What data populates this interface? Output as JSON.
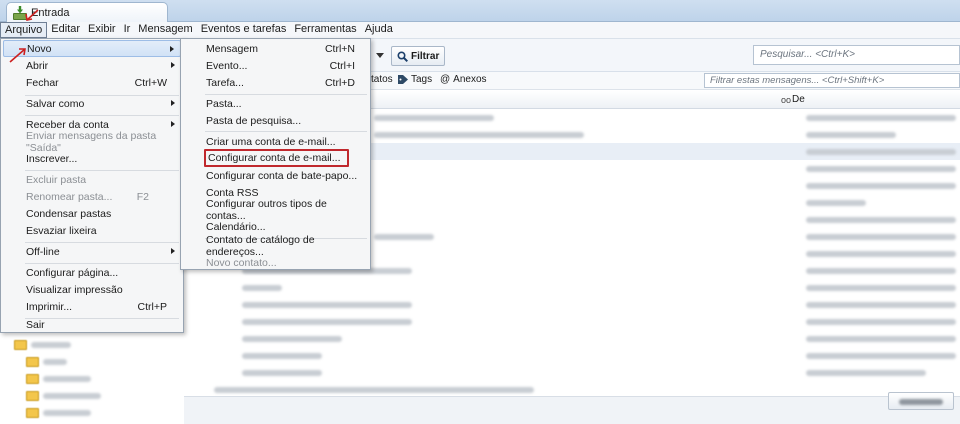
{
  "tab": {
    "label": "Entrada",
    "icon": "inbox-download-icon"
  },
  "menubar": [
    {
      "label": "Arquivo",
      "active": true
    },
    {
      "label": "Editar"
    },
    {
      "label": "Exibir"
    },
    {
      "label": "Ir"
    },
    {
      "label": "Mensagem"
    },
    {
      "label": "Eventos e tarefas"
    },
    {
      "label": "Ferramentas"
    },
    {
      "label": "Ajuda"
    }
  ],
  "toolbar": {
    "filter_label": "Filtrar",
    "search_placeholder": "Pesquisar... <Ctrl+K>"
  },
  "quick_filter": {
    "contacts_label": "tatos",
    "tags_label": "Tags",
    "attachments_label": "Anexos",
    "filter_placeholder": "Filtrar estas mensagens... <Ctrl+Shift+K>"
  },
  "columns": {
    "from_label": "De"
  },
  "arquivo_menu": [
    {
      "label": "Novo",
      "submenu": true,
      "hover": true
    },
    {
      "label": "Abrir",
      "submenu": true
    },
    {
      "label": "Fechar",
      "shortcut": "Ctrl+W"
    },
    {
      "label": "Salvar como",
      "submenu": true
    },
    {
      "label": "Receber da conta",
      "submenu": true
    },
    {
      "label": "Enviar mensagens da pasta \"Saída\"",
      "disabled": true
    },
    {
      "label": "Inscrever..."
    },
    {
      "label": "Excluir pasta",
      "disabled": true
    },
    {
      "label": "Renomear pasta...",
      "shortcut": "F2",
      "disabled": true
    },
    {
      "label": "Condensar pastas"
    },
    {
      "label": "Esvaziar lixeira"
    },
    {
      "label": "Off-line",
      "submenu": true
    },
    {
      "label": "Configurar página..."
    },
    {
      "label": "Visualizar impressão"
    },
    {
      "label": "Imprimir...",
      "shortcut": "Ctrl+P"
    },
    {
      "label": "Sair"
    }
  ],
  "novo_submenu": [
    {
      "label": "Mensagem",
      "shortcut": "Ctrl+N"
    },
    {
      "label": "Evento...",
      "shortcut": "Ctrl+I"
    },
    {
      "label": "Tarefa...",
      "shortcut": "Ctrl+D"
    },
    {
      "label": "Pasta..."
    },
    {
      "label": "Pasta de pesquisa..."
    },
    {
      "label": "Criar uma conta de e-mail..."
    },
    {
      "label": "Configurar conta de e-mail...",
      "highlighted": true
    },
    {
      "label": "Configurar conta de bate-papo..."
    },
    {
      "label": "Conta RSS"
    },
    {
      "label": "Configurar outros tipos de contas..."
    },
    {
      "label": "Calendário..."
    },
    {
      "label": "Contato de catálogo de endereços..."
    },
    {
      "label": "Novo contato...",
      "disabled": true
    }
  ],
  "colors": {
    "highlight_box": "#c0282d",
    "annotation_arrow": "#cc1f1f",
    "menu_hover": "#d1e2f6"
  }
}
